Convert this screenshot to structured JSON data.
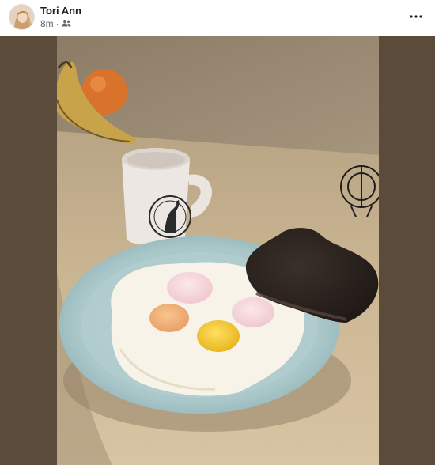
{
  "post": {
    "author": "Tori Ann",
    "time": "8m",
    "separator": "·",
    "audience_icon": "friends-icon",
    "more_icon": "more-horizontal-icon"
  },
  "colors": {
    "name_text": "#1c1e21",
    "meta_text": "#65676b",
    "photo_border": "#5b4b3a"
  }
}
